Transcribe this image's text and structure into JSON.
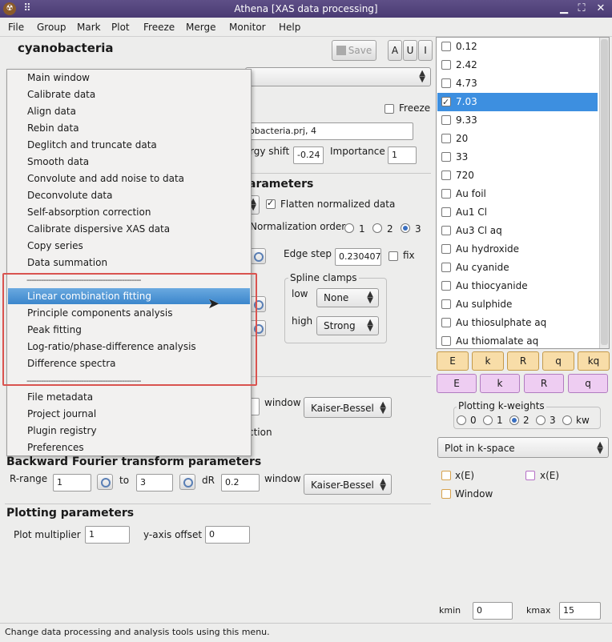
{
  "window": {
    "title": "Athena [XAS data processing]"
  },
  "menubar": [
    "File",
    "Group",
    "Mark",
    "Plot",
    "Freeze",
    "Merge",
    "Monitor",
    "Help"
  ],
  "group_name": "cyanobacteria",
  "toolbar": {
    "save": "Save",
    "a": "A",
    "u": "U",
    "i": "I"
  },
  "freeze_label": "Freeze",
  "file_field": "obacteria.prj, 4",
  "energy_shift_label": "rgy shift",
  "energy_shift_value": "-0.24",
  "importance_label": "Importance",
  "importance_value": "1",
  "norm_section": "arameters",
  "flatten_label": "Flatten normalized data",
  "norm_order_label": "Normalization order",
  "norm_orders": [
    "1",
    "2",
    "3"
  ],
  "edge_step_label": "Edge step",
  "edge_step_value": "0.230407",
  "fix_label": "fix",
  "spline_clamps": {
    "title": "Spline clamps",
    "low": "low",
    "low_val": "None",
    "high": "high",
    "high_val": "Strong"
  },
  "fwd_window_label": "window",
  "fwd_window_value": "Kaiser-Bessel",
  "fwd_partial": "ction",
  "bft": {
    "title": "Backward Fourier transform parameters",
    "rrange": "R-range",
    "r1": "1",
    "to": "to",
    "r2": "3",
    "dr_label": "dR",
    "dr": "0.2",
    "window": "window",
    "window_val": "Kaiser-Bessel"
  },
  "plotting": {
    "title": "Plotting parameters",
    "mult_label": "Plot multiplier",
    "mult": "1",
    "yoff_label": "y-axis offset",
    "yoff": "0"
  },
  "dropdown": {
    "items": [
      "Main window",
      "Calibrate data",
      "Align data",
      "Rebin data",
      "Deglitch and truncate data",
      "Smooth data",
      "Convolute and add noise to data",
      "Deconvolute data",
      "Self-absorption correction",
      "Calibrate dispersive XAS data",
      "Copy series",
      "Data summation",
      "------------------------------------------------",
      "Linear combination fitting",
      "Principle components analysis",
      "Peak fitting",
      "Log-ratio/phase-difference analysis",
      "Difference spectra",
      "------------------------------------------------",
      "File metadata",
      "Project journal",
      "Plugin registry",
      "Preferences"
    ],
    "highlighted": "Linear combination fitting"
  },
  "group_list": [
    {
      "label": "0.12",
      "checked": false,
      "selected": false
    },
    {
      "label": "2.42",
      "checked": false,
      "selected": false
    },
    {
      "label": "4.73",
      "checked": false,
      "selected": false
    },
    {
      "label": "7.03",
      "checked": true,
      "selected": true
    },
    {
      "label": "9.33",
      "checked": false,
      "selected": false
    },
    {
      "label": "20",
      "checked": false,
      "selected": false
    },
    {
      "label": "33",
      "checked": false,
      "selected": false
    },
    {
      "label": "720",
      "checked": false,
      "selected": false
    },
    {
      "label": "Au foil",
      "checked": false,
      "selected": false
    },
    {
      "label": "Au1 Cl",
      "checked": false,
      "selected": false
    },
    {
      "label": "Au3 Cl aq",
      "checked": false,
      "selected": false
    },
    {
      "label": "Au hydroxide",
      "checked": false,
      "selected": false
    },
    {
      "label": "Au cyanide",
      "checked": false,
      "selected": false
    },
    {
      "label": "Au thiocyanide",
      "checked": false,
      "selected": false
    },
    {
      "label": "Au sulphide",
      "checked": false,
      "selected": false
    },
    {
      "label": "Au thiosulphate aq",
      "checked": false,
      "selected": false
    },
    {
      "label": "Au thiomalate aq",
      "checked": false,
      "selected": false
    }
  ],
  "plot_buttons_row1": [
    "E",
    "k",
    "R",
    "q",
    "kq"
  ],
  "plot_buttons_row2": [
    "E",
    "k",
    "R",
    "q"
  ],
  "kweights": {
    "title": "Plotting k-weights",
    "options": [
      "0",
      "1",
      "2",
      "3",
      "kw"
    ],
    "selected": "2"
  },
  "plot_space": "Plot in k-space",
  "plot_options": {
    "xe1": "x(E)",
    "xe2": "x(E)",
    "window": "Window"
  },
  "kmin_label": "kmin",
  "kmin": "0",
  "kmax_label": "kmax",
  "kmax": "15",
  "status": "Change data processing and analysis tools using this menu.",
  "colors": {
    "title_bar": "#4a3b73",
    "highlight": "#3b86cc",
    "annotation": "#d9534f",
    "orange_btn": "#f8dda8",
    "purple_btn": "#eecdf2"
  }
}
